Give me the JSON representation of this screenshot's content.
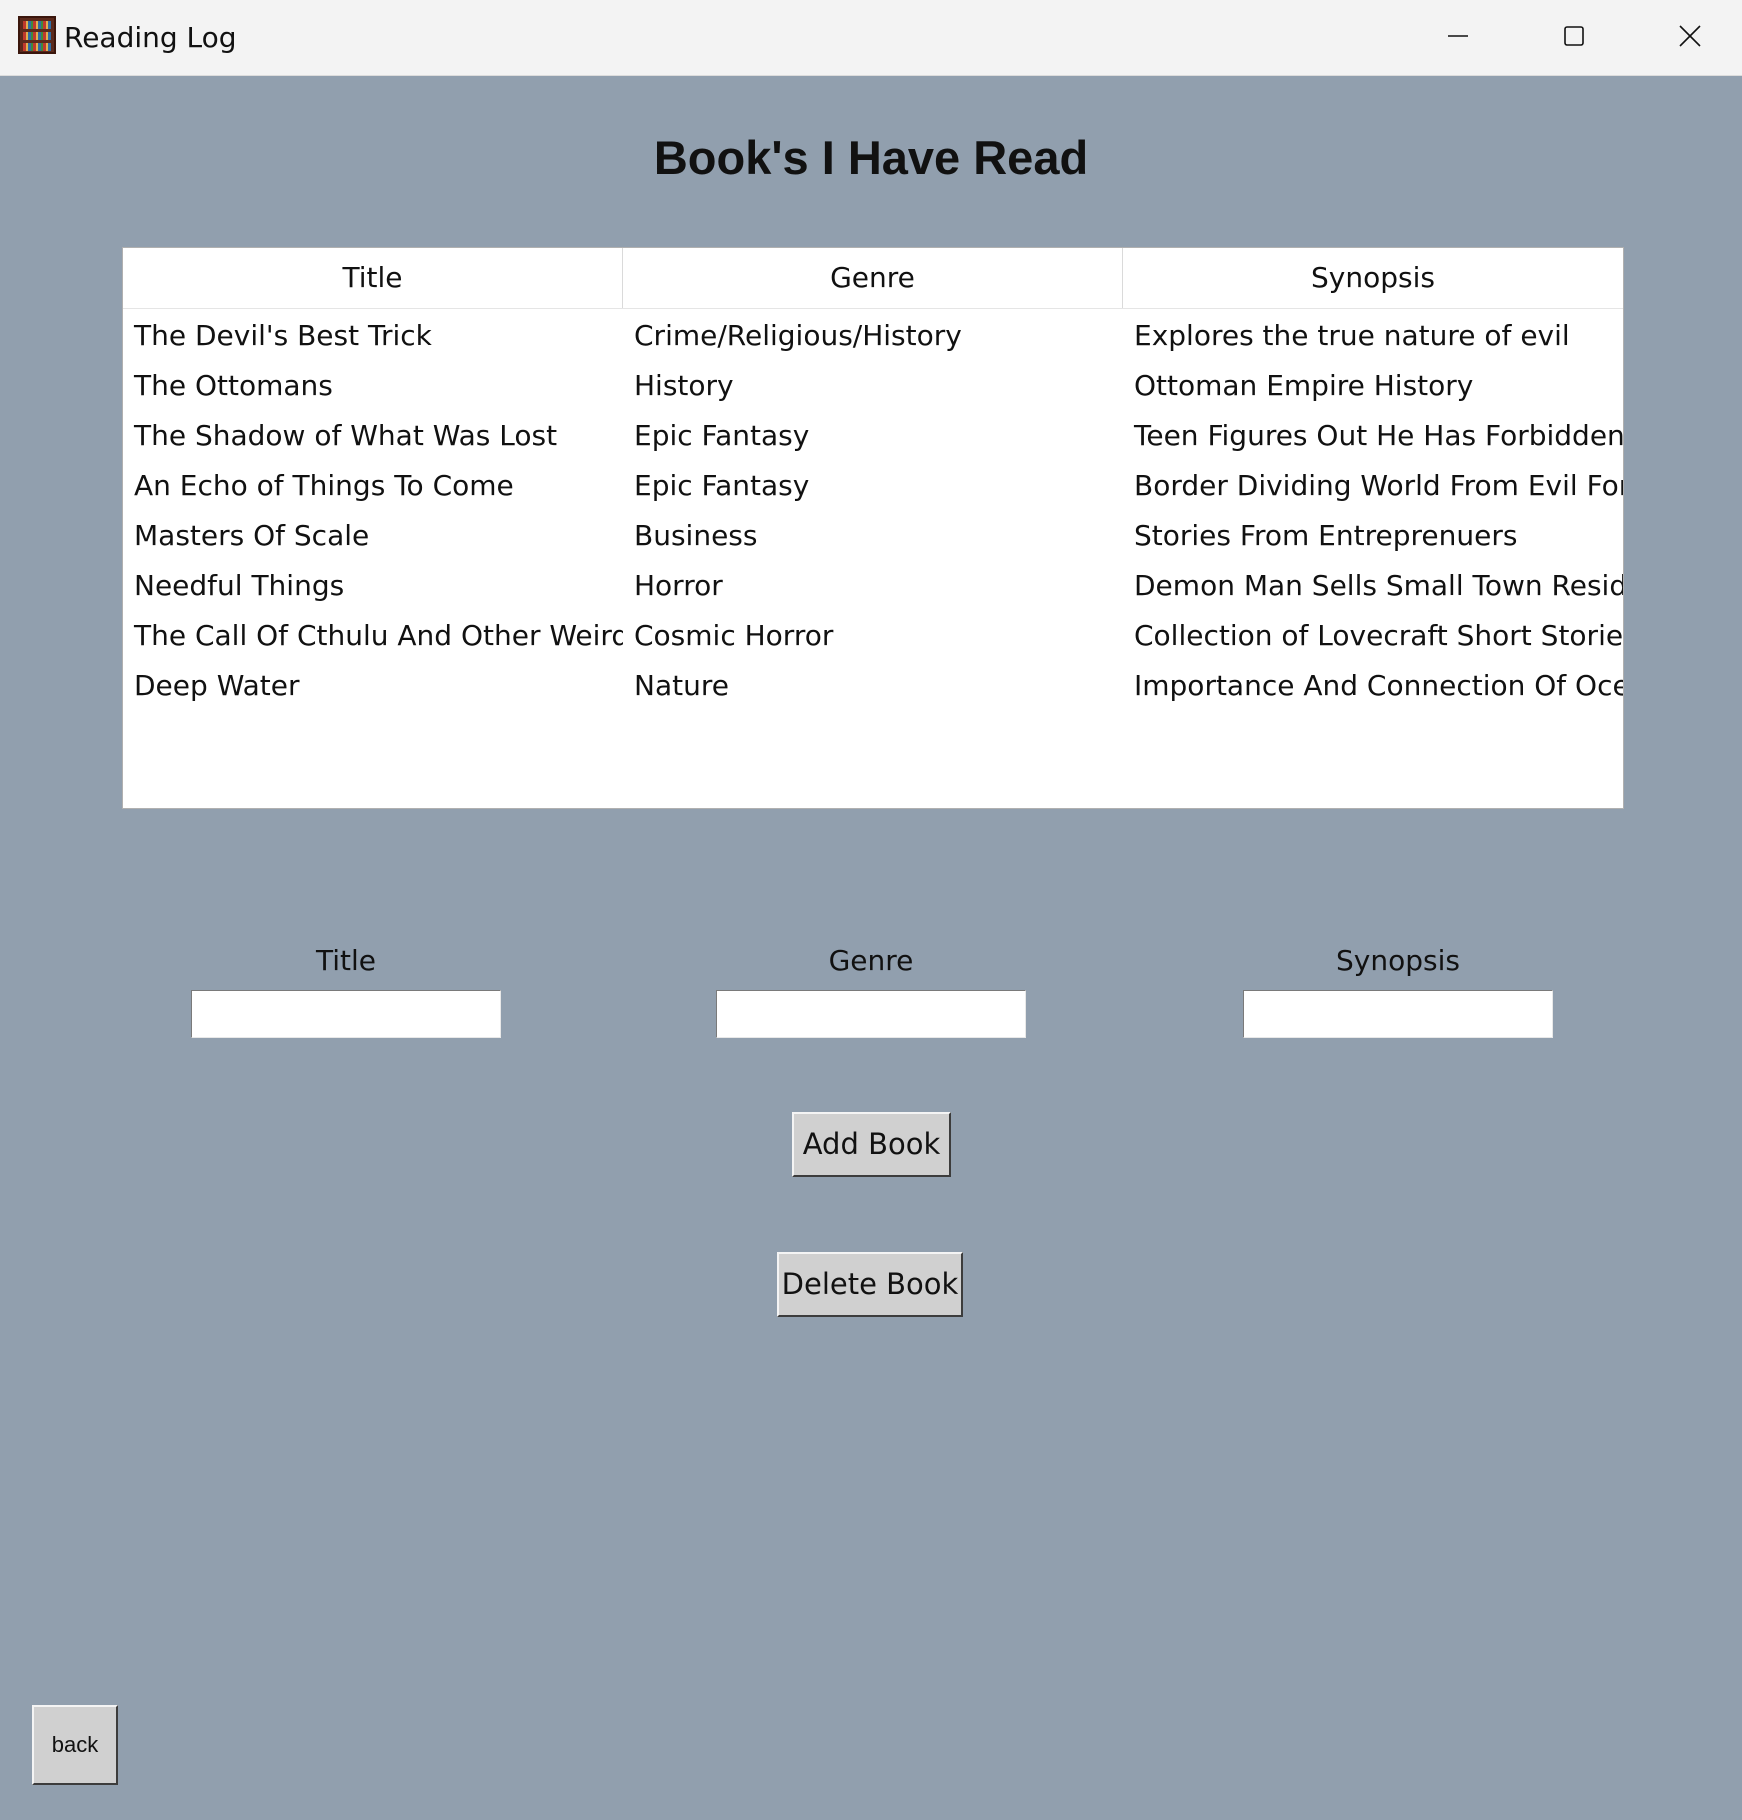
{
  "window": {
    "title": "Reading Log",
    "icon": "bookshelf-icon",
    "controls": [
      "minimize-icon",
      "maximize-icon",
      "close-icon"
    ]
  },
  "heading": "Book's I Have Read",
  "table": {
    "columns": [
      "Title",
      "Genre",
      "Synopsis"
    ],
    "rows": [
      [
        "The Devil's Best Trick",
        "Crime/Religious/History",
        "Explores the true nature of evil"
      ],
      [
        "The Ottomans",
        "History",
        "Ottoman Empire History"
      ],
      [
        "The Shadow of What Was Lost",
        "Epic Fantasy",
        "Teen Figures Out He Has Forbidden I"
      ],
      [
        "An Echo of Things To Come",
        "Epic Fantasy",
        "Border Dividing World From Evil Forc"
      ],
      [
        "Masters Of Scale",
        "Business",
        "Stories From Entreprenuers"
      ],
      [
        "Needful Things",
        "Horror",
        "Demon Man Sells Small Town Reside"
      ],
      [
        "The Call Of Cthulu And Other Weird",
        "Cosmic Horror",
        "Collection of Lovecraft Short Stories"
      ],
      [
        "Deep Water",
        "Nature",
        "Importance And Connection Of Oce"
      ]
    ]
  },
  "form": {
    "title_label": "Title",
    "title_value": "",
    "genre_label": "Genre",
    "genre_value": "",
    "synopsis_label": "Synopsis",
    "synopsis_value": ""
  },
  "buttons": {
    "add": "Add Book",
    "delete": "Delete Book",
    "back": "back"
  },
  "colors": {
    "background": "#919fae",
    "titlebar": "#f3f3f3",
    "button_face": "#d0d0d0"
  }
}
